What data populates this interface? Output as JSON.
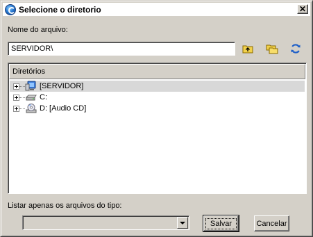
{
  "window": {
    "title": "Selecione o diretorio",
    "close_glyph": "✕"
  },
  "filename": {
    "label": "Nome do arquivo:",
    "value": "SERVIDOR\\"
  },
  "toolbar": {
    "icons": [
      "folder-up-icon",
      "new-folder-icon",
      "refresh-icon"
    ]
  },
  "tree": {
    "header": "Diretórios",
    "items": [
      {
        "label": "[SERVIDOR]",
        "icon": "network-computer-icon",
        "selected": true
      },
      {
        "label": "C:",
        "icon": "hard-drive-icon",
        "selected": false
      },
      {
        "label": "D: [Audio CD]",
        "icon": "cd-drive-icon",
        "selected": false
      }
    ]
  },
  "filter": {
    "label": "Listar apenas os arquivos do tipo:",
    "selected": ""
  },
  "buttons": {
    "save": "Salvar",
    "cancel": "Cancelar"
  },
  "colors": {
    "face": "#d4d0c8",
    "selection": "#d8d8d8",
    "refresh_blue": "#1e5fc8",
    "folder_yellow": "#f2d14b"
  }
}
